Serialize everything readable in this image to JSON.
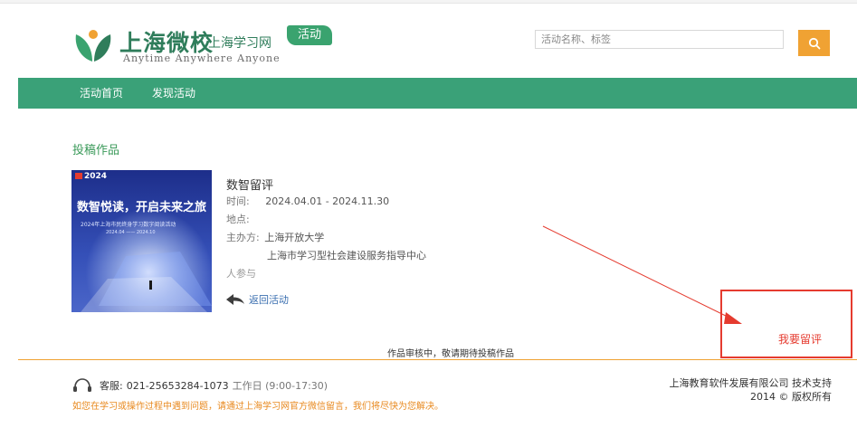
{
  "header": {
    "logo_title": "上海微校",
    "logo_subtitle": "上海学习网",
    "logo_badge": "活动",
    "logo_tagline": "Anytime  Anywhere  Anyone",
    "search_placeholder": "活动名称、标签",
    "search_icon": "magnifier-icon",
    "accent_color": "#f0a233"
  },
  "nav": {
    "items": [
      {
        "label": "活动首页"
      },
      {
        "label": "发现活动"
      }
    ],
    "bg_color": "#3aa178"
  },
  "main": {
    "section_title": "投稿作品",
    "poster": {
      "year": "2024",
      "headline": "数智悦读，开启未来之旅",
      "caption": "2024年上海市民终身学习数字阅读活动",
      "dates": "2024.04 —— 2024.10"
    },
    "activity": {
      "title": "数智留评",
      "time_label": "时间:",
      "time_value": "2024.04.01 - 2024.11.30",
      "place_label": "地点:",
      "organizer_label": "主办方:",
      "organizers": [
        "上海开放大学",
        "上海市学习型社会建设服务指导中心"
      ],
      "participants": "人参与",
      "back_label": "返回活动"
    },
    "comment_button": "我要留评",
    "review_note": "作品审核中，敬请期待投稿作品",
    "annotation_color": "#e53b2f"
  },
  "footer": {
    "service_label": "客服:",
    "service_phone": "021-25653284-1073",
    "service_hours": "工作日 (9:00-17:30)",
    "help_text": "如您在学习或操作过程中遇到问题，请通过上海学习网官方微信留言，我们将尽快为您解决。",
    "support": "上海教育软件发展有限公司 技术支持",
    "copyright": "2014 © 版权所有"
  }
}
